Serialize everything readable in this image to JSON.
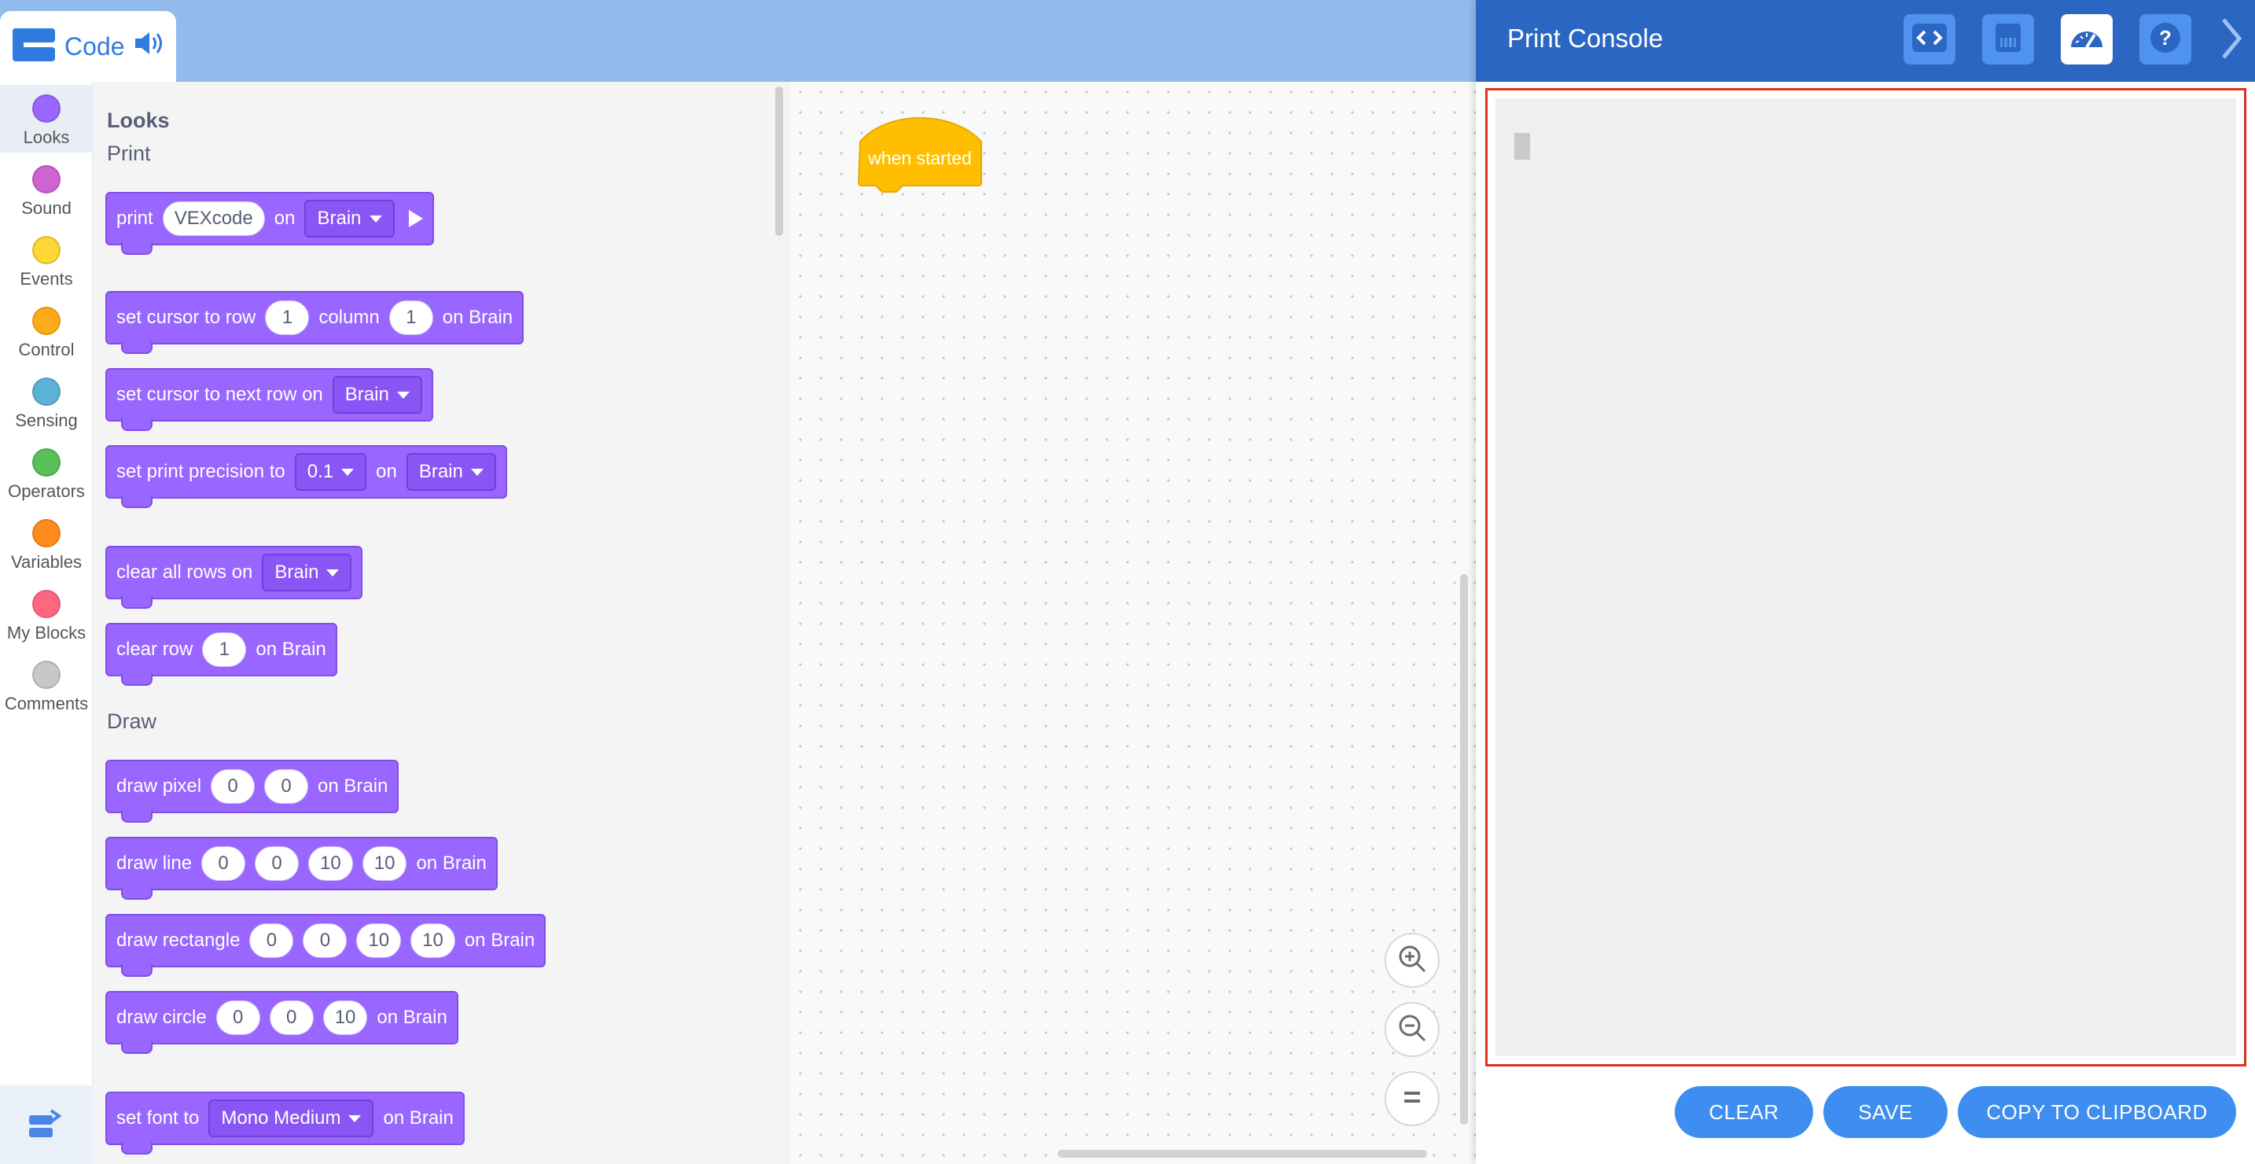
{
  "topbar": {
    "code_label": "Code"
  },
  "categories": [
    {
      "label": "Looks",
      "color": "#9966ff"
    },
    {
      "label": "Sound",
      "color": "#cf63cf"
    },
    {
      "label": "Events",
      "color": "#ffd633"
    },
    {
      "label": "Control",
      "color": "#ffab19"
    },
    {
      "label": "Sensing",
      "color": "#5cb1d6"
    },
    {
      "label": "Operators",
      "color": "#59c059"
    },
    {
      "label": "Variables",
      "color": "#ff8c1a"
    },
    {
      "label": "My Blocks",
      "color": "#ff6680"
    },
    {
      "label": "Comments",
      "color": "#c8c8c8"
    }
  ],
  "flyout": {
    "heading": "Looks",
    "print_section": "Print",
    "draw_section": "Draw",
    "print_block": {
      "t1": "print",
      "value": "VEXcode",
      "t2": "on",
      "device": "Brain"
    },
    "set_cursor_block": {
      "t1": "set cursor to row",
      "row": "1",
      "t2": "column",
      "col": "1",
      "t3": "on Brain"
    },
    "next_row_block": {
      "t1": "set cursor to next row on",
      "device": "Brain"
    },
    "precision_block": {
      "t1": "set print precision to",
      "value": "0.1",
      "t2": "on",
      "device": "Brain"
    },
    "clear_all_block": {
      "t1": "clear all rows on",
      "device": "Brain"
    },
    "clear_row_block": {
      "t1": "clear row",
      "row": "1",
      "t2": "on Brain"
    },
    "draw_pixel_block": {
      "t1": "draw pixel",
      "a": "0",
      "b": "0",
      "t2": "on Brain"
    },
    "draw_line_block": {
      "t1": "draw line",
      "a": "0",
      "b": "0",
      "c": "10",
      "d": "10",
      "t2": "on Brain"
    },
    "draw_rect_block": {
      "t1": "draw rectangle",
      "a": "0",
      "b": "0",
      "c": "10",
      "d": "10",
      "t2": "on Brain"
    },
    "draw_circle_block": {
      "t1": "draw circle",
      "a": "0",
      "b": "0",
      "c": "10",
      "t2": "on Brain"
    },
    "set_font_block": {
      "t1": "set font to",
      "font": "Mono Medium",
      "t2": "on Brain"
    }
  },
  "workspace": {
    "hat_block": "when started"
  },
  "panel": {
    "title": "Print Console",
    "clear_label": "CLEAR",
    "save_label": "SAVE",
    "copy_label": "COPY TO CLIPBOARD"
  },
  "colors": {
    "looks_block": "#9966ff",
    "events_block": "#ffbf00",
    "panel_header": "#2a66c2",
    "accent_button": "#3d8ef0",
    "console_border": "#e0301e"
  }
}
